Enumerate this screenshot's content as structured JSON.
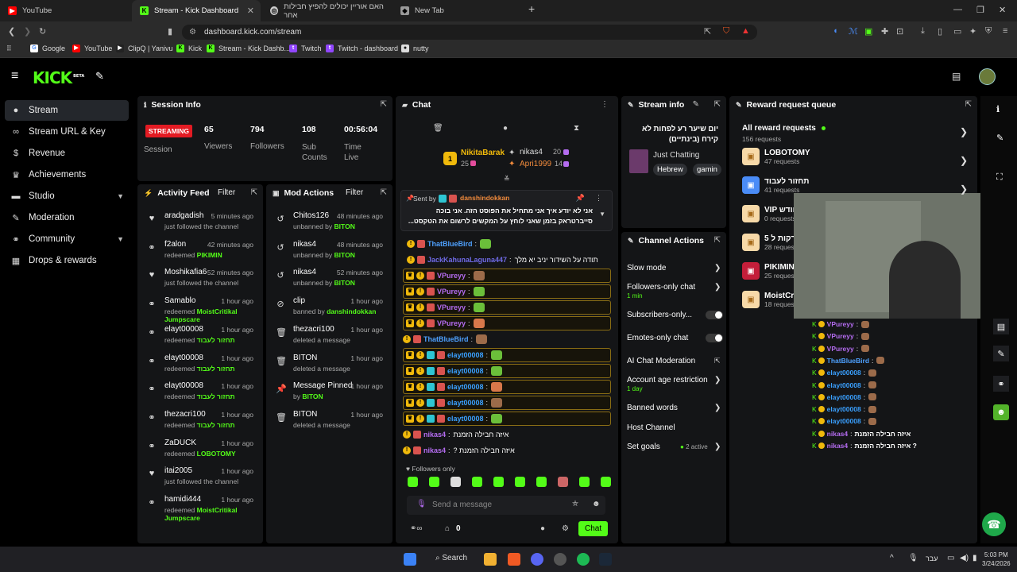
{
  "browser": {
    "tabs": [
      {
        "title": "YouTube",
        "icon": "youtube-icon"
      },
      {
        "title": "Stream - Kick Dashboard",
        "icon": "kick-icon"
      },
      {
        "title": "האם אוריין יכולים להפיץ חבילות אחר",
        "icon": "web-icon"
      },
      {
        "title": "New Tab",
        "icon": "shield-icon"
      }
    ],
    "url": "dashboard.kick.com/stream",
    "bookmarks": [
      "Google",
      "YouTube",
      "ClipQ | Yanivu",
      "Kick",
      "Stream - Kick Dashb...",
      "Twitch",
      "Twitch - dashboard",
      "nutty"
    ]
  },
  "app": {
    "logo": "KICK",
    "beta": "BETA"
  },
  "sidebar": {
    "items": [
      {
        "label": "Stream",
        "icon": "stream-icon",
        "active": true
      },
      {
        "label": "Stream URL & Key",
        "icon": "link-icon"
      },
      {
        "label": "Revenue",
        "icon": "dollar-icon"
      },
      {
        "label": "Achievements",
        "icon": "trophy-icon"
      },
      {
        "label": "Studio",
        "icon": "studio-icon",
        "expandable": true
      },
      {
        "label": "Moderation",
        "icon": "wrench-icon"
      },
      {
        "label": "Community",
        "icon": "community-icon",
        "expandable": true
      },
      {
        "label": "Drops & rewards",
        "icon": "gift-icon"
      }
    ]
  },
  "session": {
    "title": "Session Info",
    "status": "STREAMING",
    "stats": [
      {
        "value": "65",
        "label": "Viewers"
      },
      {
        "value": "794",
        "label": "Followers"
      },
      {
        "value": "108",
        "label": "Sub Counts"
      },
      {
        "value": "00:56:04",
        "label": "Time Live"
      }
    ],
    "session_label": "Session"
  },
  "activity": {
    "title": "Activity Feed",
    "filter": "Filter",
    "items": [
      {
        "name": "aradgadish",
        "time": "5 minutes ago",
        "desc": "just followed the channel",
        "icon": "heart-icon"
      },
      {
        "name": "f2alon",
        "time": "42 minutes ago",
        "desc": "redeemed",
        "reward": "PIKIMIN",
        "icon": "reward-icon"
      },
      {
        "name": "Moshikafia6",
        "time": "52 minutes ago",
        "desc": "just followed the channel",
        "icon": "heart-icon"
      },
      {
        "name": "Samablo",
        "time": "1 hour ago",
        "desc": "redeemed",
        "reward": "MoistCritikal Jumpscare",
        "icon": "reward-icon"
      },
      {
        "name": "elayt00008",
        "time": "1 hour ago",
        "desc": "redeemed",
        "reward": "תחזור לעבוד",
        "icon": "reward-icon"
      },
      {
        "name": "elayt00008",
        "time": "1 hour ago",
        "desc": "redeemed",
        "reward": "תחזור לעבוד",
        "icon": "reward-icon"
      },
      {
        "name": "elayt00008",
        "time": "1 hour ago",
        "desc": "redeemed",
        "reward": "תחזור לעבוד",
        "icon": "reward-icon"
      },
      {
        "name": "thezacri100",
        "time": "1 hour ago",
        "desc": "redeemed",
        "reward": "תחזור לעבוד",
        "icon": "reward-icon"
      },
      {
        "name": "ZaDUCK",
        "time": "1 hour ago",
        "desc": "redeemed",
        "reward": "LOBOTOMY",
        "icon": "reward-icon"
      },
      {
        "name": "itai2005",
        "time": "1 hour ago",
        "desc": "just followed the channel",
        "icon": "heart-icon"
      },
      {
        "name": "hamidi444",
        "time": "1 hour ago",
        "desc": "redeemed",
        "reward": "MoistCritikal Jumpscare",
        "icon": "reward-icon"
      }
    ]
  },
  "mod": {
    "title": "Mod Actions",
    "filter": "Filter",
    "items": [
      {
        "name": "Chitos126",
        "time": "48 minutes ago",
        "desc": "unbanned by",
        "by": "BITON",
        "icon": "unban-icon"
      },
      {
        "name": "nikas4",
        "time": "48 minutes ago",
        "desc": "unbanned by",
        "by": "BITON",
        "icon": "unban-icon"
      },
      {
        "name": "nikas4",
        "time": "52 minutes ago",
        "desc": "unbanned by",
        "by": "BITON",
        "icon": "unban-icon"
      },
      {
        "name": "clip",
        "time": "1 hour ago",
        "desc": "banned by",
        "by": "danshindokkan",
        "icon": "ban-icon"
      },
      {
        "name": "thezacri100",
        "time": "1 hour ago",
        "desc": "deleted a message",
        "by": "",
        "icon": "trash-icon"
      },
      {
        "name": "BITON",
        "time": "1 hour ago",
        "desc": "deleted a message",
        "by": "",
        "icon": "trash-icon"
      },
      {
        "name": "Message Pinned",
        "time": "1 hour ago",
        "desc": "by",
        "by": "BITON",
        "icon": "pin-icon"
      },
      {
        "name": "BITON",
        "time": "1 hour ago",
        "desc": "deleted a message",
        "by": "",
        "icon": "trash-icon"
      }
    ]
  },
  "chat": {
    "title": "Chat",
    "top": [
      {
        "name": "NikitaBarak",
        "count": "25"
      },
      {
        "name": "nikas4",
        "count": "20"
      },
      {
        "name": "Apri1999",
        "count": "14"
      }
    ],
    "pinned": {
      "label": "Sent by",
      "by": "danshindokkan",
      "line1": "אני לא יודע איך אני מתחיל את הפוסט הזה. אני בוכה",
      "line2": "סייברטראק בזמן שאני לוחץ על המקשים לרשום את הטקסט..."
    },
    "messages": [
      {
        "user": "ThatBlueBird",
        "color": "#4ea1ff",
        "text": "",
        "hl": false
      },
      {
        "user": "JackKahunaLaguna447",
        "color": "#6f6ae6",
        "text": "תודה על השידור יניב יא מלך",
        "hl": false
      },
      {
        "user": "VPureyy",
        "color": "#b46cf0",
        "text": "",
        "hl": true
      },
      {
        "user": "VPureyy",
        "color": "#b46cf0",
        "text": "",
        "hl": true
      },
      {
        "user": "VPureyy",
        "color": "#b46cf0",
        "text": "",
        "hl": true
      },
      {
        "user": "VPureyy",
        "color": "#b46cf0",
        "text": "",
        "hl": true
      },
      {
        "user": "ThatBlueBird",
        "color": "#4ea1ff",
        "text": "",
        "hl": false
      },
      {
        "user": "elayt00008",
        "color": "#3aa0ff",
        "text": "",
        "hl": true
      },
      {
        "user": "elayt00008",
        "color": "#3aa0ff",
        "text": "",
        "hl": true
      },
      {
        "user": "elayt00008",
        "color": "#3aa0ff",
        "text": "",
        "hl": true
      },
      {
        "user": "elayt00008",
        "color": "#3aa0ff",
        "text": "",
        "hl": true
      },
      {
        "user": "elayt00008",
        "color": "#3aa0ff",
        "text": "",
        "hl": true
      },
      {
        "user": "nikas4",
        "color": "#b46cf0",
        "text": "איזה חבילה הזמנת",
        "hl": false
      },
      {
        "user": "nikas4",
        "color": "#b46cf0",
        "text": "איזה חבילה הזמנת ?",
        "hl": false
      }
    ],
    "followers_only": "Followers only",
    "placeholder": "Send a message",
    "send": "Chat",
    "count": "0"
  },
  "streaminfo": {
    "title": "Stream info",
    "stream_title": "יום שיער רע לפחות לא קירח (בינתיים)",
    "category": "Just Chatting",
    "tags": [
      "Hebrew",
      "gamin"
    ]
  },
  "channel": {
    "title": "Channel Actions",
    "items": [
      {
        "label": "Slow mode",
        "type": "arrow"
      },
      {
        "label": "Followers-only chat",
        "sub": "1 min",
        "type": "arrow"
      },
      {
        "label": "Subscribers-only...",
        "type": "toggle"
      },
      {
        "label": "Emotes-only chat",
        "type": "toggle"
      },
      {
        "label": "AI Chat Moderation",
        "type": "ext"
      },
      {
        "label": "Account age restriction",
        "sub": "1 day",
        "type": "arrow"
      },
      {
        "label": "Banned words",
        "type": "arrow"
      },
      {
        "label": "Host Channel",
        "type": "none"
      },
      {
        "label": "Set goals",
        "extra": "2 active",
        "type": "arrow"
      }
    ]
  },
  "rewards": {
    "title": "Reward request queue",
    "all_label": "All reward requests",
    "all_count": "156 requests",
    "items": [
      {
        "name": "LOBOTOMY",
        "count": "47 requests"
      },
      {
        "name": "תחזור לעבוד",
        "count": "41 requests"
      },
      {
        "name": "VIP חודש",
        "count": "0 requests"
      },
      {
        "name": "5 דקות ל",
        "count": "28 requests"
      },
      {
        "name": "PIKIMIN",
        "count": "25 requests"
      },
      {
        "name": "MoistCri",
        "count": "18 requests"
      }
    ]
  },
  "overlay_chat": [
    {
      "user": "VPureyy",
      "color": "#b46cf0",
      "text": ""
    },
    {
      "user": "VPureyy",
      "color": "#b46cf0",
      "text": ""
    },
    {
      "user": "VPureyy",
      "color": "#b46cf0",
      "text": ""
    },
    {
      "user": "ThatBlueBird",
      "color": "#4ea1ff",
      "text": ""
    },
    {
      "user": "elayt00008",
      "color": "#3aa0ff",
      "text": ""
    },
    {
      "user": "elayt00008",
      "color": "#3aa0ff",
      "text": ""
    },
    {
      "user": "elayt00008",
      "color": "#3aa0ff",
      "text": ""
    },
    {
      "user": "elayt00008",
      "color": "#3aa0ff",
      "text": ""
    },
    {
      "user": "elayt00008",
      "color": "#3aa0ff",
      "text": ""
    },
    {
      "user": "nikas4",
      "color": "#b46cf0",
      "text": "איזה חבילה הזמנת"
    },
    {
      "user": "nikas4",
      "color": "#b46cf0",
      "text": "איזה חבילה הזמנת ?"
    }
  ],
  "taskbar": {
    "search": "Search",
    "lang": "עבר",
    "time": "5:03 PM",
    "date": "3/24/2026"
  },
  "colors": {
    "accent": "#53fc18",
    "streaming": "#e31b23",
    "panel": "#141517"
  }
}
